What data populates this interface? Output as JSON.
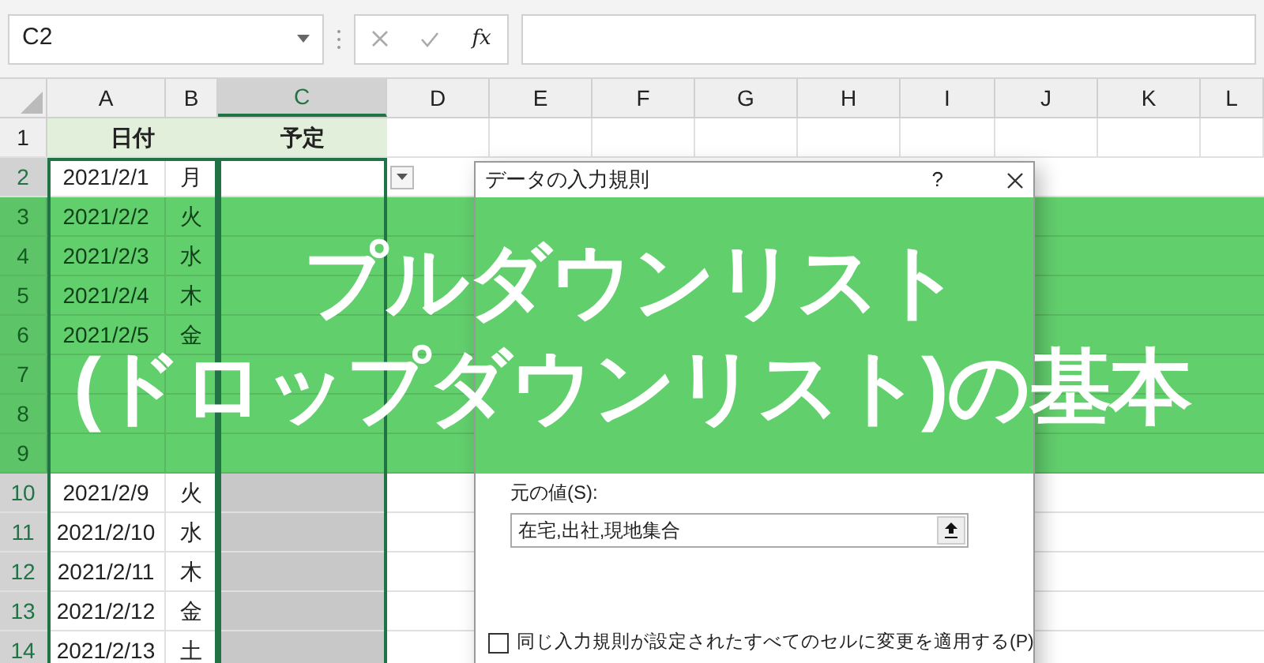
{
  "name_box": "C2",
  "formula_bar": {
    "function_label": "fx"
  },
  "columns": [
    {
      "label": "A",
      "selected": false
    },
    {
      "label": "B",
      "selected": false
    },
    {
      "label": "C",
      "selected": true
    },
    {
      "label": "D",
      "selected": false
    },
    {
      "label": "E",
      "selected": false
    },
    {
      "label": "F",
      "selected": false
    },
    {
      "label": "G",
      "selected": false
    },
    {
      "label": "H",
      "selected": false
    },
    {
      "label": "I",
      "selected": false
    },
    {
      "label": "J",
      "selected": false
    },
    {
      "label": "K",
      "selected": false
    },
    {
      "label": "L",
      "selected": false
    }
  ],
  "header_row": {
    "number": "1",
    "date_label": "日付",
    "plan_label": "予定"
  },
  "rows": [
    {
      "number": "2",
      "date": "2021/2/1",
      "day": "月",
      "selected": true
    },
    {
      "number": "3",
      "date": "2021/2/2",
      "day": "火",
      "selected": true
    },
    {
      "number": "4",
      "date": "2021/2/3",
      "day": "水",
      "selected": true
    },
    {
      "number": "5",
      "date": "2021/2/4",
      "day": "木",
      "selected": true
    },
    {
      "number": "6",
      "date": "2021/2/5",
      "day": "金",
      "selected": true
    },
    {
      "number": "7",
      "selected": true
    },
    {
      "number": "8",
      "selected": true
    },
    {
      "number": "9",
      "selected": true
    },
    {
      "number": "10",
      "date": "2021/2/9",
      "day": "火",
      "selected": true
    },
    {
      "number": "11",
      "date": "2021/2/10",
      "day": "水",
      "selected": true
    },
    {
      "number": "12",
      "date": "2021/2/11",
      "day": "木",
      "selected": true
    },
    {
      "number": "13",
      "date": "2021/2/12",
      "day": "金",
      "selected": true
    },
    {
      "number": "14",
      "date": "2021/2/13",
      "day": "土",
      "selected": true
    }
  ],
  "dialog": {
    "title": "データの入力規則",
    "help": "?",
    "source_label": "元の値(S):",
    "source_value": "在宅,出社,現地集合",
    "apply_all": {
      "label": "同じ入力規則が設定されたすべてのセルに変更を適用する(P)",
      "checked": false
    }
  },
  "banner": {
    "lines": [
      "プルダウンリスト",
      "(ドロップダウンリスト)の基本"
    ]
  }
}
